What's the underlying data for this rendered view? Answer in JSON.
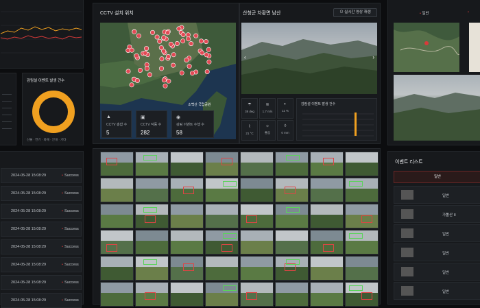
{
  "map_panel": {
    "title": "CCTV 설치 위치",
    "stats": [
      {
        "icon": "alert-icon",
        "label": "CCTV 총합 수",
        "value": "5"
      },
      {
        "icon": "camera-icon",
        "label": "CCTV 작동 수",
        "value": "282"
      },
      {
        "icon": "pin-icon",
        "label": "감림 이벤트 수행 수",
        "value": "58"
      }
    ],
    "marker_label": "소백산 국립공원"
  },
  "video_panel": {
    "title": "산청군 차황면 남산",
    "button": "실시간 영상 재생",
    "weather": [
      {
        "icon": "rain-icon",
        "text": "38 deg"
      },
      {
        "icon": "wind-icon",
        "text": "1.7 m/s"
      },
      {
        "icon": "humidity-icon",
        "text": "11 %"
      },
      {
        "icon": "temp-icon",
        "text": "21 °C"
      },
      {
        "icon": "sun-icon",
        "text": "좋음"
      },
      {
        "icon": "drop-icon",
        "text": "0 mm"
      }
    ],
    "event_chart_title": "감림설 이벤트 발생 건수"
  },
  "donut_panel": {
    "title": "감림설 이벤트 발생 건수",
    "legend": [
      "산불",
      "연기",
      "화재",
      "안개",
      "기타"
    ]
  },
  "logs": [
    {
      "date": "2024-05-28 15:08:29",
      "status": "Success"
    },
    {
      "date": "2024-05-28 15:08:29",
      "status": "Success"
    },
    {
      "date": "2024-05-28 15:08:29",
      "status": "Success"
    },
    {
      "date": "2024-05-28 15:08:29",
      "status": "Success"
    },
    {
      "date": "2024-05-28 15:08:29",
      "status": "Success"
    },
    {
      "date": "2024-05-28 15:08:29",
      "status": "Success"
    },
    {
      "date": "2024-05-28 15:08:29",
      "status": "Success"
    },
    {
      "date": "2024-05-28 15:08:29",
      "status": "Success"
    }
  ],
  "right_panel": {
    "tab": "일반",
    "events_title": "이벤트 리스트",
    "events_header": "일반",
    "events": [
      {
        "label": "일반"
      },
      {
        "label": "가톨산 II"
      },
      {
        "label": "일반"
      },
      {
        "label": "일반"
      },
      {
        "label": "일반"
      },
      {
        "label": "일반"
      }
    ]
  },
  "colors": {
    "background": "#0c0d0f",
    "panel": "#17191c",
    "accent_red": "#d83a3a",
    "donut_orange": "#f0a020"
  }
}
